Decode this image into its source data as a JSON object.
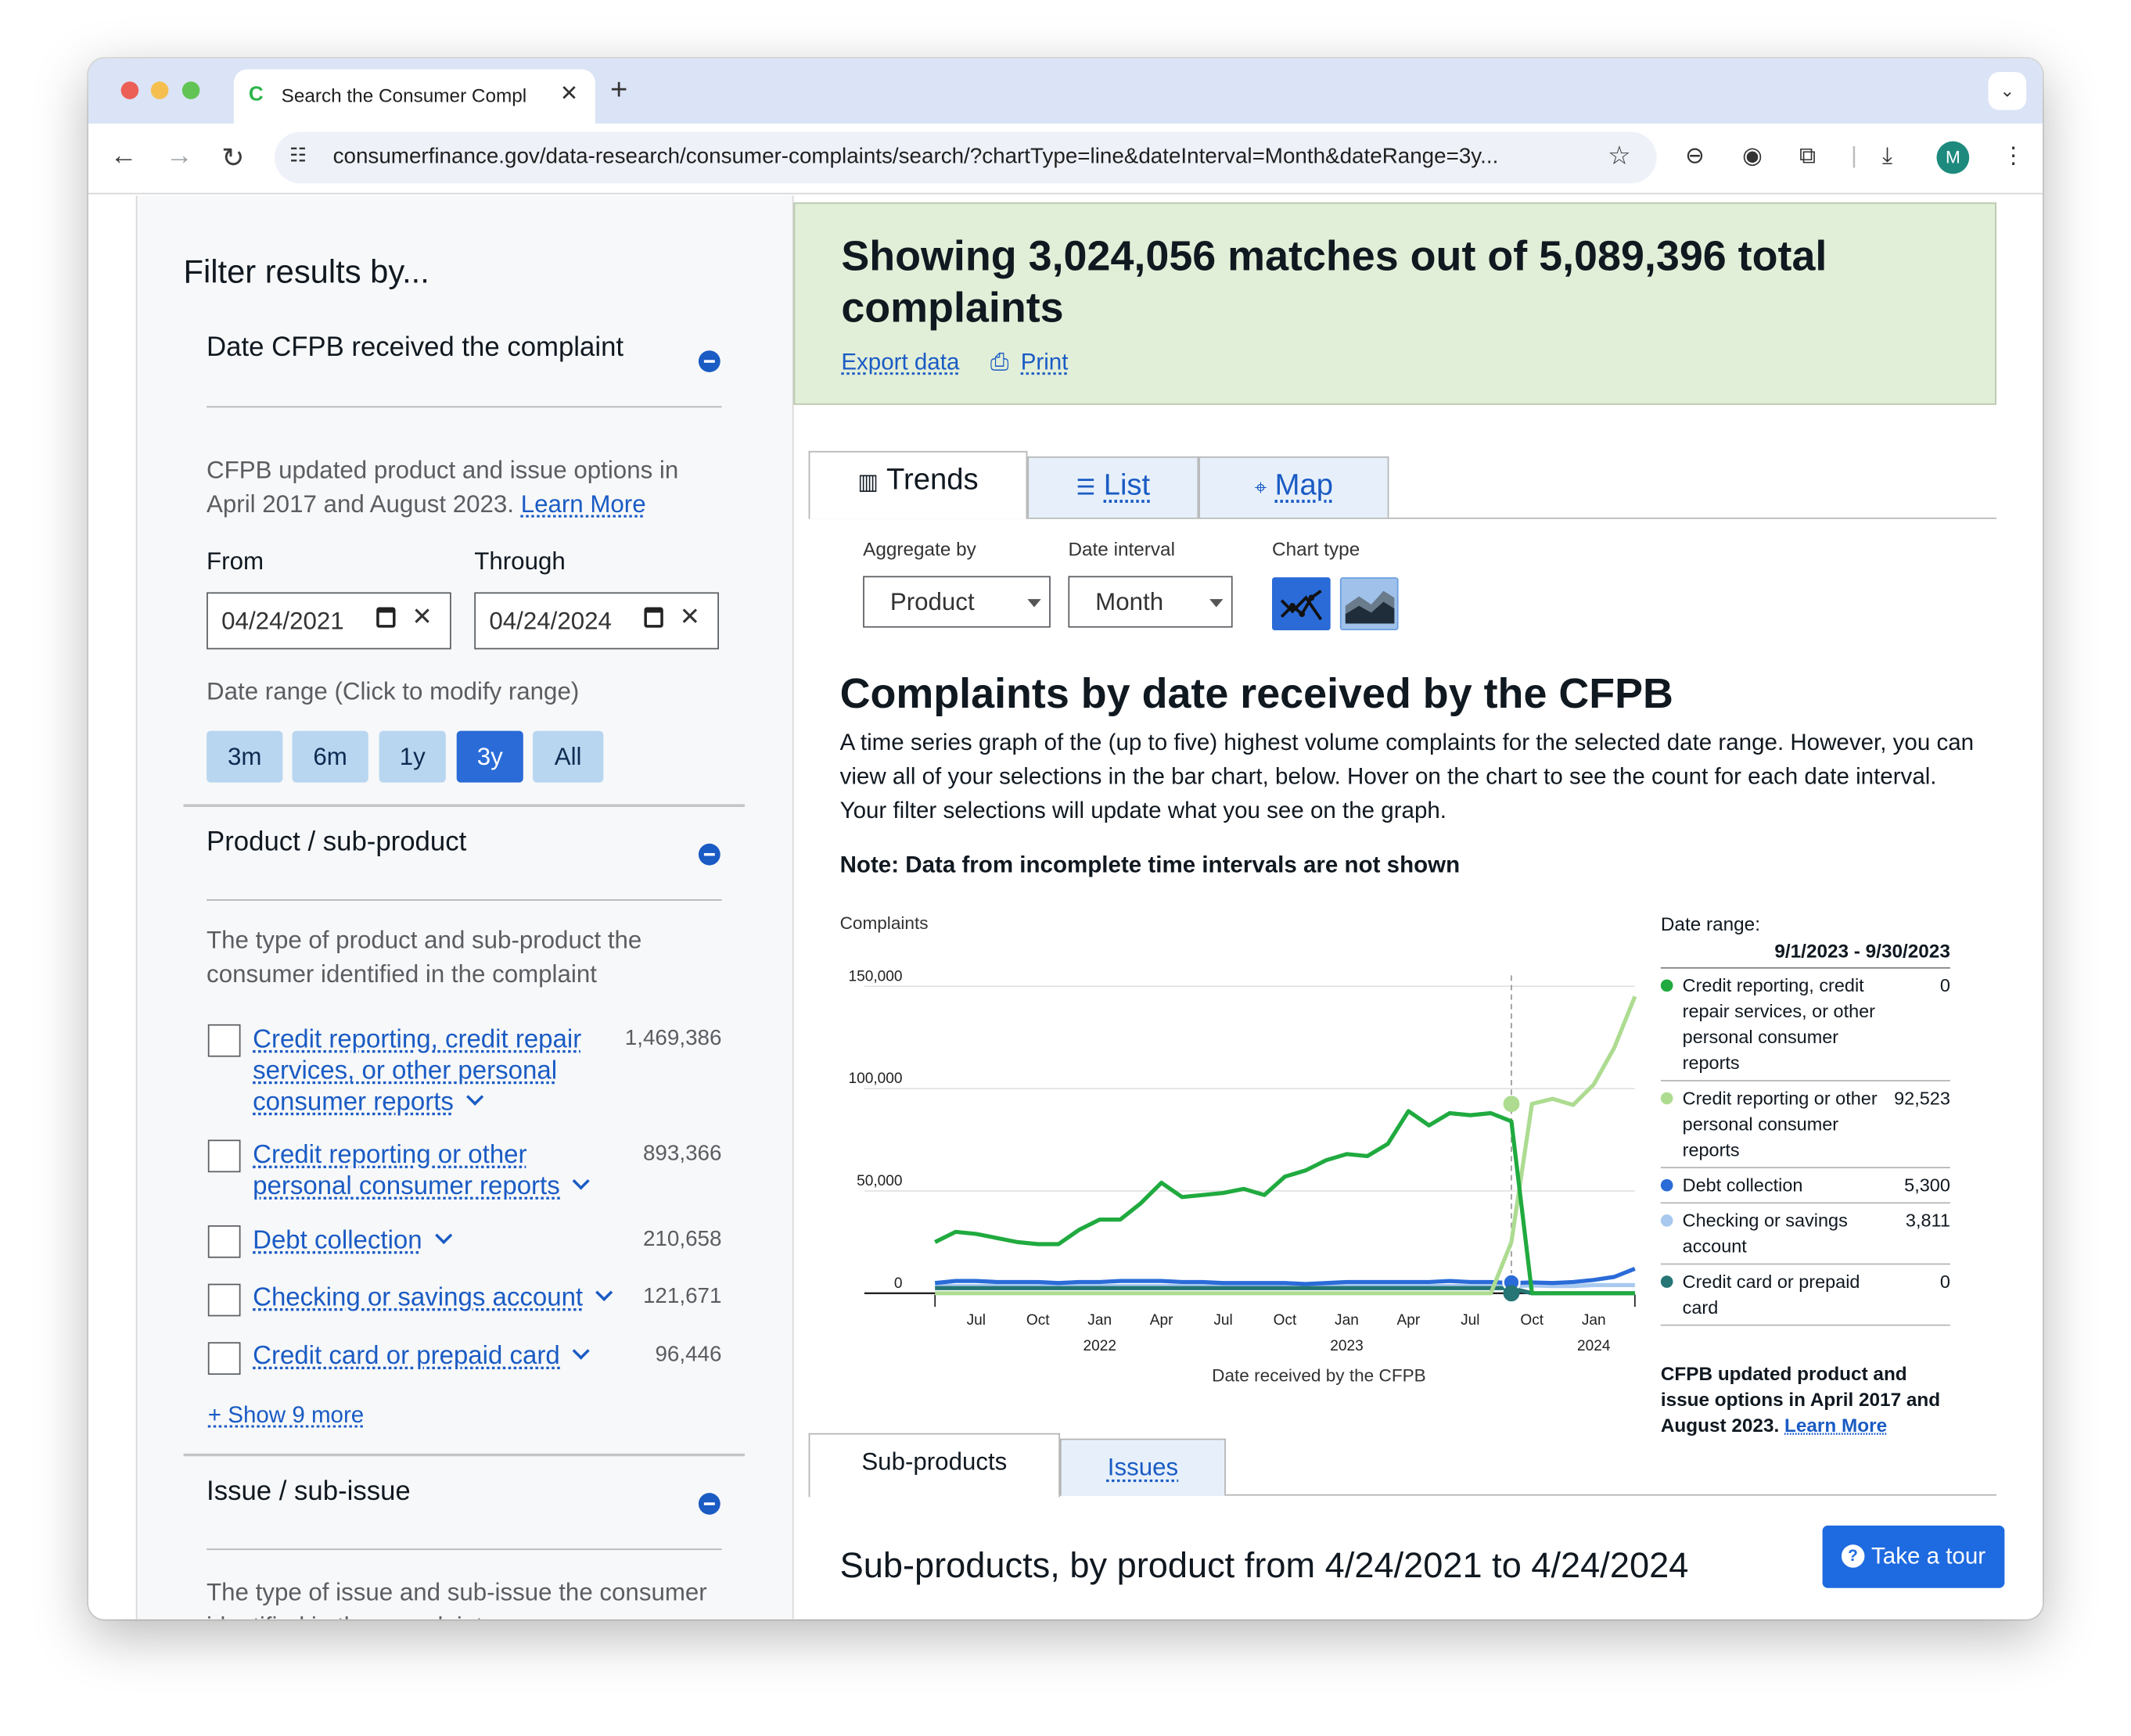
{
  "browser": {
    "tab_title": "Search the Consumer Compl",
    "favicon": "C",
    "url": "consumerfinance.gov/data-research/consumer-complaints/search/?chartType=line&dateInterval=Month&dateRange=3y...",
    "avatar_letter": "M"
  },
  "sidebar": {
    "heading": "Filter results by...",
    "date_section": {
      "title": "Date CFPB received the complaint",
      "note": "CFPB updated product and issue options in April 2017 and August 2023.",
      "learn_more": "Learn More",
      "from_label": "From",
      "through_label": "Through",
      "from_value": "04/24/2021",
      "through_value": "04/24/2024",
      "range_label": "Date range (Click to modify range)",
      "ranges": [
        "3m",
        "6m",
        "1y",
        "3y",
        "All"
      ],
      "active_range": "3y"
    },
    "product_section": {
      "title": "Product / sub-product",
      "description": "The type of product and sub-product the consumer identified in the complaint",
      "items": [
        {
          "label": "Credit reporting, credit repair services, or other personal consumer reports",
          "count": "1,469,386"
        },
        {
          "label": "Credit reporting or other personal consumer reports",
          "count": "893,366"
        },
        {
          "label": "Debt collection",
          "count": "210,658"
        },
        {
          "label": "Checking or savings account",
          "count": "121,671"
        },
        {
          "label": "Credit card or prepaid card",
          "count": "96,446"
        }
      ],
      "show_more": "+ Show 9 more"
    },
    "issue_section": {
      "title": "Issue / sub-issue",
      "description": "The type of issue and sub-issue the consumer identified in the complaint"
    }
  },
  "main": {
    "banner_title": "Showing 3,024,056 matches out of 5,089,396 total complaints",
    "export_label": "Export data",
    "print_label": "Print",
    "view_tabs": [
      "Trends",
      "List",
      "Map"
    ],
    "active_view_tab": "Trends",
    "aggregate_label": "Aggregate by",
    "aggregate_value": "Product",
    "interval_label": "Date interval",
    "interval_value": "Month",
    "chart_type_label": "Chart type",
    "chart_title": "Complaints by date received by the CFPB",
    "chart_description": "A time series graph of the (up to five) highest volume complaints for the selected date range. However, you can view all of your selections in the bar chart, below. Hover on the chart to see the count for each date interval. Your filter selections will update what you see on the graph.",
    "note": "Note:  Data from incomplete time intervals are not shown",
    "legend": {
      "date_range_label": "Date range:",
      "date_range_value": "9/1/2023 - 9/30/2023",
      "items": [
        {
          "name": "Credit reporting, credit repair services, or other personal consumer reports",
          "value": "0",
          "color": "#20aa3f"
        },
        {
          "name": "Credit reporting or other personal consumer reports",
          "value": "92,523",
          "color": "#addc91"
        },
        {
          "name": "Debt collection",
          "value": "5,300",
          "color": "#2a6bd8"
        },
        {
          "name": "Checking or savings account",
          "value": "3,811",
          "color": "#a9c9ef"
        },
        {
          "name": "Credit card or prepaid card",
          "value": "0",
          "color": "#257675"
        }
      ],
      "footnote": "CFPB updated product and issue options in April 2017 and August 2023.",
      "learn_more": "Learn More"
    },
    "bottom_tabs": [
      "Sub-products",
      "Issues"
    ],
    "active_bottom_tab": "Sub-products",
    "subproducts_title": "Sub-products, by product from 4/24/2021 to 4/24/2024",
    "tour_button": "Take a tour"
  },
  "chart_data": {
    "type": "line",
    "ylabel": "Complaints",
    "xlabel": "Date received by the CFPB",
    "yticks": [
      "150,000",
      "100,000",
      "50,000",
      "0"
    ],
    "ylim": [
      0,
      150000
    ],
    "xticks": [
      {
        "label": "Jul",
        "year": ""
      },
      {
        "label": "Oct",
        "year": ""
      },
      {
        "label": "Jan",
        "year": "2022"
      },
      {
        "label": "Apr",
        "year": ""
      },
      {
        "label": "Jul",
        "year": ""
      },
      {
        "label": "Oct",
        "year": ""
      },
      {
        "label": "Jan",
        "year": "2023"
      },
      {
        "label": "Apr",
        "year": ""
      },
      {
        "label": "Jul",
        "year": ""
      },
      {
        "label": "Oct",
        "year": ""
      },
      {
        "label": "Jan",
        "year": "2024"
      }
    ],
    "x": [
      "2021-05",
      "2021-06",
      "2021-07",
      "2021-08",
      "2021-09",
      "2021-10",
      "2021-11",
      "2021-12",
      "2022-01",
      "2022-02",
      "2022-03",
      "2022-04",
      "2022-05",
      "2022-06",
      "2022-07",
      "2022-08",
      "2022-09",
      "2022-10",
      "2022-11",
      "2022-12",
      "2023-01",
      "2023-02",
      "2023-03",
      "2023-04",
      "2023-05",
      "2023-06",
      "2023-07",
      "2023-08",
      "2023-09",
      "2023-10",
      "2023-11",
      "2023-12",
      "2024-01",
      "2024-02",
      "2024-03"
    ],
    "hover_index": 28,
    "series": [
      {
        "name": "Credit reporting, credit repair services, or other personal consumer reports",
        "color": "#20aa3f",
        "values": [
          25000,
          30000,
          29000,
          27000,
          25000,
          24000,
          24000,
          31000,
          36000,
          36000,
          44000,
          54000,
          47000,
          48000,
          49000,
          51000,
          48000,
          57000,
          60000,
          65000,
          68000,
          67000,
          73000,
          89000,
          82000,
          88000,
          87000,
          88000,
          84000,
          0,
          0,
          0,
          0,
          0,
          0
        ]
      },
      {
        "name": "Credit reporting or other personal consumer reports",
        "color": "#addc91",
        "values": [
          0,
          0,
          0,
          0,
          0,
          0,
          0,
          0,
          0,
          0,
          0,
          0,
          0,
          0,
          0,
          0,
          0,
          0,
          0,
          0,
          0,
          0,
          0,
          0,
          0,
          0,
          0,
          0,
          25000,
          92523,
          95000,
          92000,
          102000,
          120000,
          145000
        ]
      },
      {
        "name": "Debt collection",
        "color": "#2a6bd8",
        "values": [
          5000,
          6000,
          6000,
          5500,
          5500,
          5500,
          5000,
          5500,
          5500,
          6000,
          6000,
          6000,
          5500,
          5500,
          5000,
          5000,
          5000,
          5000,
          4500,
          5000,
          5500,
          5500,
          5500,
          5500,
          5500,
          6000,
          5500,
          5500,
          5000,
          5300,
          5000,
          5500,
          6500,
          8000,
          12000
        ]
      },
      {
        "name": "Checking or savings account",
        "color": "#a9c9ef",
        "values": [
          3500,
          3500,
          3500,
          3500,
          3500,
          3500,
          3500,
          3500,
          3500,
          3500,
          3500,
          3500,
          3500,
          3500,
          3500,
          3500,
          3500,
          3500,
          3500,
          3500,
          3500,
          3500,
          3500,
          3500,
          3500,
          3500,
          3500,
          3500,
          3500,
          3811,
          3500,
          3500,
          4000,
          4000,
          4000
        ]
      },
      {
        "name": "Credit card or prepaid card",
        "color": "#257675",
        "values": [
          2500,
          2500,
          2500,
          2500,
          2500,
          2500,
          2500,
          2500,
          2500,
          2500,
          2500,
          2500,
          2500,
          2500,
          2500,
          2500,
          2500,
          2500,
          2500,
          2500,
          2500,
          2500,
          2500,
          2500,
          2500,
          2500,
          2500,
          2500,
          2500,
          0,
          0,
          0,
          0,
          0,
          0
        ]
      }
    ]
  }
}
